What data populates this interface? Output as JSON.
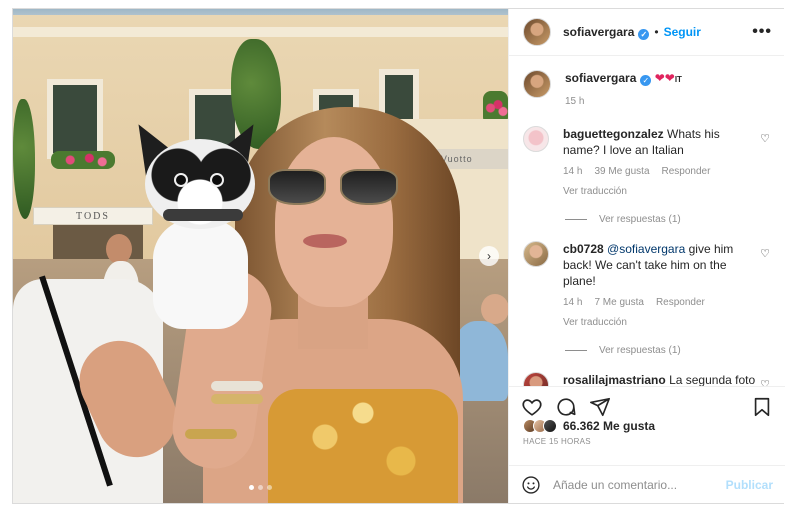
{
  "post": {
    "username": "sofiavergara",
    "follow_label": "Seguir",
    "separator": "•",
    "more_label": "•••"
  },
  "photo": {
    "shop_sign_left": "TODS",
    "shop_sign_right": "F. Vuotto",
    "carousel_position": 1,
    "carousel_count": 3
  },
  "caption": {
    "username": "sofiavergara",
    "text": "❤❤",
    "flag": "IT",
    "time": "15 h"
  },
  "comments": [
    {
      "username": "baguettegonzalez",
      "text": "Whats his name? I love an Italian",
      "time": "14 h",
      "likes": "39 Me gusta",
      "reply": "Responder",
      "translate": "Ver traducción",
      "replies": "Ver respuestas (1)"
    },
    {
      "username": "cb0728",
      "mention": "@sofiavergara",
      "text": "give him back! We can't take him on the plane!",
      "time": "14 h",
      "likes": "7 Me gusta",
      "reply": "Responder",
      "translate": "Ver traducción",
      "replies": "Ver respuestas (1)"
    },
    {
      "username": "rosalilajmastriano",
      "text": "La segunda foto"
    }
  ],
  "engagement": {
    "likes_count": "66.362",
    "likes_suffix": "Me gusta",
    "age": "HACE 15 HORAS"
  },
  "add_comment": {
    "placeholder": "Añade un comentario...",
    "post_label": "Publicar"
  },
  "icons": {
    "verified": "verified-badge-icon",
    "like": "heart-icon",
    "comment": "comment-bubble-icon",
    "share": "paper-plane-icon",
    "save": "bookmark-icon",
    "emoji": "smiley-icon",
    "next": "chevron-right-icon"
  },
  "colors": {
    "accent": "#0095f6",
    "verified": "#3897f0",
    "heart": "#e0245e",
    "muted": "#8e8e8e",
    "post_disabled": "#b2dffc"
  }
}
